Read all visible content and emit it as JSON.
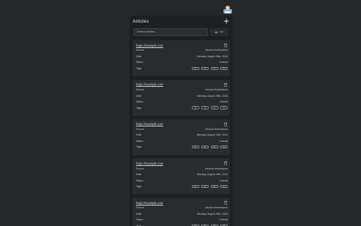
{
  "header": {
    "title": "Articles"
  },
  "search": {
    "placeholder": "Search articles..."
  },
  "filter": {
    "selected": "All"
  },
  "fields": {
    "source": "Source",
    "date": "Date",
    "status": "Status",
    "tags": "Tags"
  },
  "articles": [
    {
      "url": "https://example.com",
      "source": "chrome://extensions",
      "date": "Monday, August 26th, 2024",
      "status": "Unread",
      "tags": [
        "tag",
        "tag",
        "tag",
        "tag"
      ]
    },
    {
      "url": "https://example.com",
      "source": "chrome://extensions",
      "date": "Monday, August 26th, 2024",
      "status": "Unread",
      "tags": [
        "tag",
        "tag",
        "tag",
        "tag"
      ]
    },
    {
      "url": "https://example.com",
      "source": "chrome://extensions",
      "date": "Monday, August 26th, 2024",
      "status": "Unread",
      "tags": [
        "tag",
        "tag",
        "tag",
        "tag"
      ]
    },
    {
      "url": "https://example.com",
      "source": "chrome://extensions",
      "date": "Monday, August 26th, 2024",
      "status": "Unread",
      "tags": [
        "tag",
        "tag",
        "tag",
        "tag"
      ]
    },
    {
      "url": "https://example.com",
      "source": "chrome://extensions",
      "date": "Monday, August 26th, 2024",
      "status": "Unread",
      "tags": [
        "tag",
        "tag",
        "tag",
        "tag"
      ]
    }
  ]
}
